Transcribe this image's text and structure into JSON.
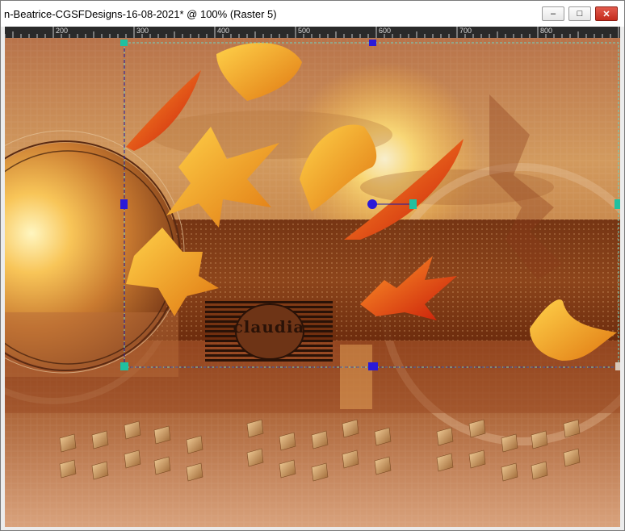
{
  "window": {
    "title": "n-Beatrice-CGSFDesigns-16-08-2021* @ 100% (Raster 5)",
    "minimize_icon": "minimize-icon",
    "maximize_icon": "maximize-icon",
    "close_icon": "close-icon"
  },
  "ruler": {
    "labels": [
      "200",
      "300",
      "400",
      "500",
      "600",
      "700",
      "800"
    ]
  },
  "canvas": {
    "watermark_text": "claudia",
    "colors": {
      "sky_top": "#c98a55",
      "sun": "#fff3a8",
      "stripe": "#7a3512",
      "water": "#a7552a",
      "bottom": "#d8a07a",
      "selection": "#6fd3c4",
      "handle_blue": "#2a1ad8",
      "handle_teal": "#20c0a0"
    }
  }
}
